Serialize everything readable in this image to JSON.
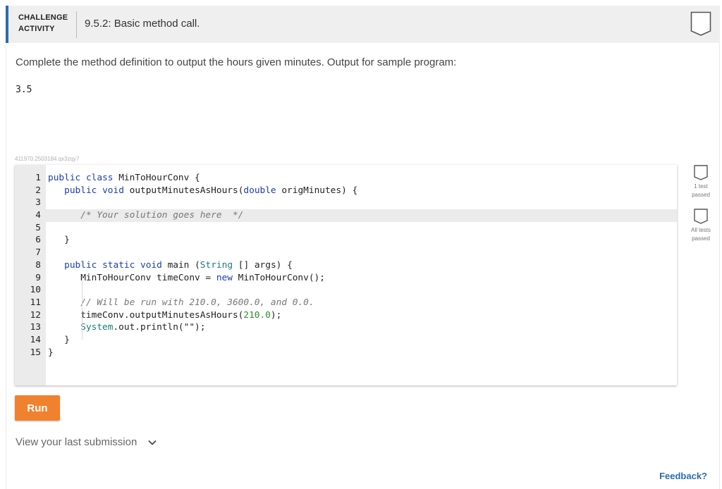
{
  "header": {
    "tag_line1": "CHALLENGE",
    "tag_line2": "ACTIVITY",
    "title": "9.5.2: Basic method call."
  },
  "instructions": "Complete the method definition to output the hours given minutes. Output for sample program:",
  "sample_output": "3.5",
  "activity_id": "411970.2503184.qx3zqy7",
  "code_lines": [
    "public class MinToHourConv {",
    "   public void outputMinutesAsHours(double origMinutes) {",
    "",
    "      /* Your solution goes here  */",
    "",
    "   }",
    "",
    "   public static void main (String [] args) {",
    "      MinToHourConv timeConv = new MinToHourConv();",
    "",
    "      // Will be run with 210.0, 3600.0, and 0.0.",
    "      timeConv.outputMinutesAsHours(210.0);",
    "      System.out.println(\"\");",
    "   }",
    "}"
  ],
  "tests": [
    {
      "label_line1": "1 test",
      "label_line2": "passed"
    },
    {
      "label_line1": "All tests",
      "label_line2": "passed"
    }
  ],
  "run_label": "Run",
  "view_submission_label": "View your last submission",
  "feedback_label": "Feedback?",
  "colors": {
    "accent_blue": "#2b6cb0",
    "run_orange": "#f0812f",
    "keyword": "#1b3fa8",
    "number": "#2e8b2e"
  },
  "icons": [
    "completion-badge-icon",
    "test-status-icon",
    "chevron-down-icon"
  ]
}
